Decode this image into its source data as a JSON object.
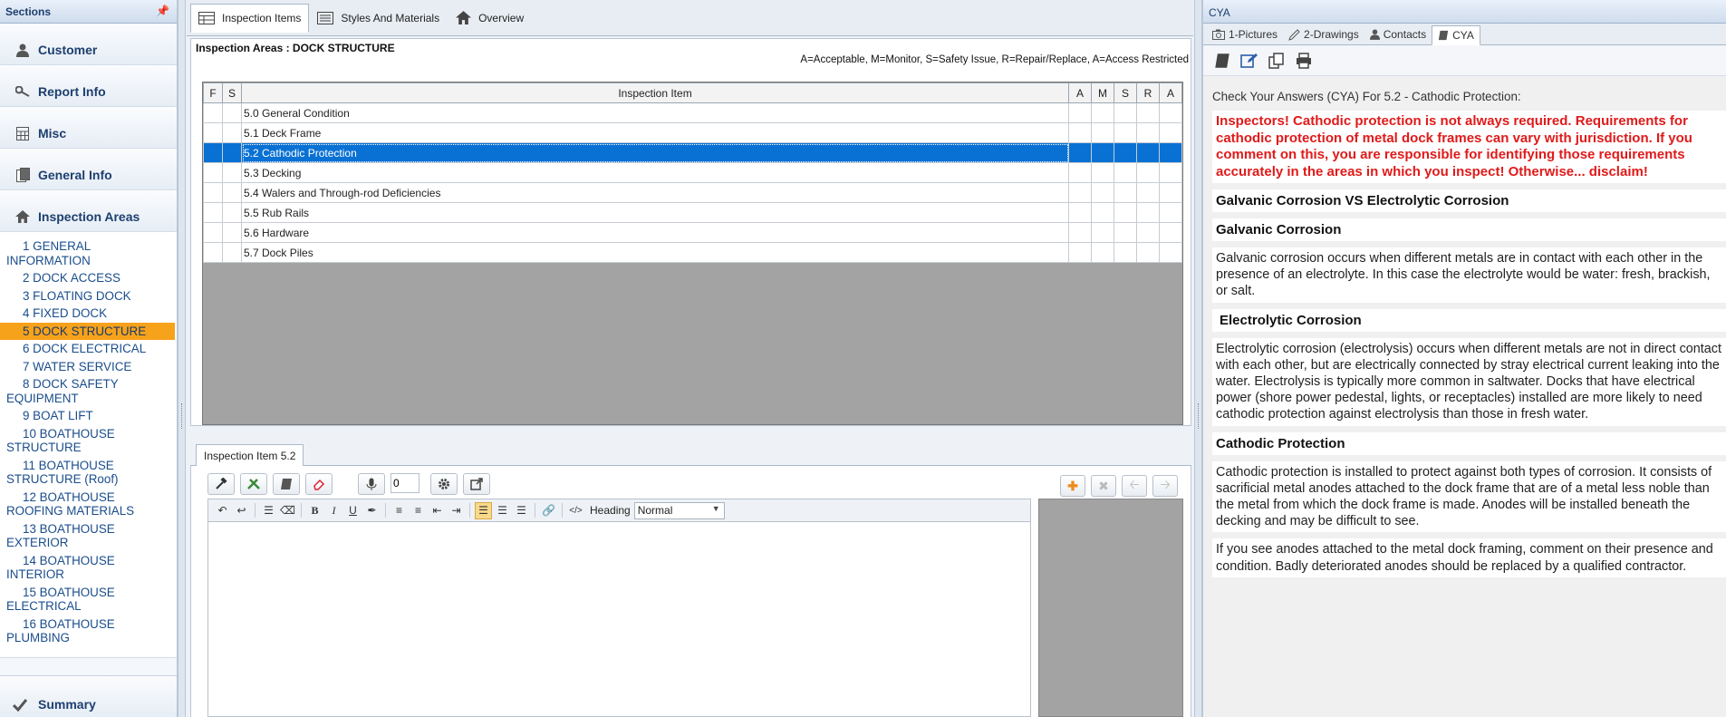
{
  "sidebar": {
    "title": "Sections",
    "nav": [
      {
        "label": "Customer"
      },
      {
        "label": "Report Info"
      },
      {
        "label": "Misc"
      },
      {
        "label": "General Info"
      },
      {
        "label": "Inspection Areas"
      }
    ],
    "areas": [
      "1 GENERAL INFORMATION",
      "2 DOCK ACCESS",
      "3 FLOATING DOCK",
      "4 FIXED DOCK",
      "5 DOCK STRUCTURE",
      "6 DOCK ELECTRICAL",
      "7 WATER SERVICE",
      "8 DOCK SAFETY EQUIPMENT",
      "9 BOAT LIFT",
      "10 BOATHOUSE STRUCTURE",
      "11 BOATHOUSE STRUCTURE (Roof)",
      "12 BOATHOUSE ROOFING MATERIALS",
      "13 BOATHOUSE EXTERIOR",
      "14 BOATHOUSE INTERIOR",
      "15 BOATHOUSE ELECTRICAL",
      "16 BOATHOUSE PLUMBING"
    ],
    "active_area": "5 DOCK STRUCTURE",
    "summary": "Summary"
  },
  "main": {
    "tabs": [
      {
        "label": "Inspection Items",
        "icon": "grid-icon"
      },
      {
        "label": "Styles And Materials",
        "icon": "list-icon"
      },
      {
        "label": "Overview",
        "icon": "house-icon"
      }
    ],
    "area_title": "Inspection Areas : DOCK STRUCTURE",
    "legend": "A=Acceptable, M=Monitor, S=Safety Issue, R=Repair/Replace, A=Access Restricted",
    "grid": {
      "headers": {
        "f": "F",
        "s": "S",
        "item": "Inspection Item",
        "a": "A",
        "m": "M",
        "s2": "S",
        "r": "R",
        "a2": "A"
      },
      "rows": [
        "5.0 General Condition",
        "5.1 Deck Frame",
        "5.2 Cathodic Protection",
        "5.3 Decking",
        "5.4 Walers and Through-rod Deficiencies",
        "5.5 Rub Rails",
        "5.6 Hardware",
        "5.7 Dock Piles"
      ],
      "selected_row": "5.2 Cathodic Protection"
    },
    "detail": {
      "tab_label": "Inspection Item 5.2",
      "count_value": "0",
      "heading_label": "Heading",
      "heading_value": "Normal"
    }
  },
  "right": {
    "title": "CYA",
    "tabs": [
      {
        "label": "1-Pictures",
        "icon": "camera-icon"
      },
      {
        "label": "2-Drawings",
        "icon": "pencil-icon"
      },
      {
        "label": "Contacts",
        "icon": "person-icon"
      },
      {
        "label": "CYA",
        "icon": "book-icon"
      }
    ],
    "intro": "Check Your Answers (CYA) For 5.2 - Cathodic Protection:",
    "warning": "Inspectors! Cathodic protection is not always required. Requirements for cathodic protection of metal dock frames can vary with jurisdiction. If you comment on this, you are responsible for identifying those requirements accurately in the areas in which you inspect! Otherwise... disclaim!",
    "h_vs": "Galvanic Corrosion VS Electrolytic Corrosion",
    "h_galvanic": "Galvanic Corrosion",
    "p_galvanic": "Galvanic corrosion occurs when different metals are in contact with each other in the presence of an electrolyte. In this case the electrolyte would be water: fresh, brackish, or salt.",
    "h_electrolytic": "Electrolytic Corrosion",
    "p_electrolytic": "Electrolytic corrosion (electrolysis) occurs when different metals are not in direct contact with each other, but are electrically connected by stray electrical current leaking into the water. Electrolysis is typically more common in saltwater. Docks that have electrical power (shore power pedestal, lights, or receptacles) installed are more likely to need cathodic protection against electrolysis than those in fresh water.",
    "h_cathodic": "Cathodic Protection",
    "p_cathodic": "Cathodic protection is installed to protect against both types of corrosion. It consists of sacrificial metal anodes attached to the dock frame that are of a metal less noble than the metal from which the dock frame is made. Anodes will be installed beneath the decking and may be difficult to see.",
    "p_anodes": "If you see anodes attached to the metal dock framing, comment on their presence and condition. Badly deteriorated anodes should be replaced by a qualified contractor."
  },
  "colors": {
    "selection": "#0a71d4",
    "active_area": "#f7a21b",
    "warning": "#e01a1a",
    "link": "#1a4d8c"
  }
}
